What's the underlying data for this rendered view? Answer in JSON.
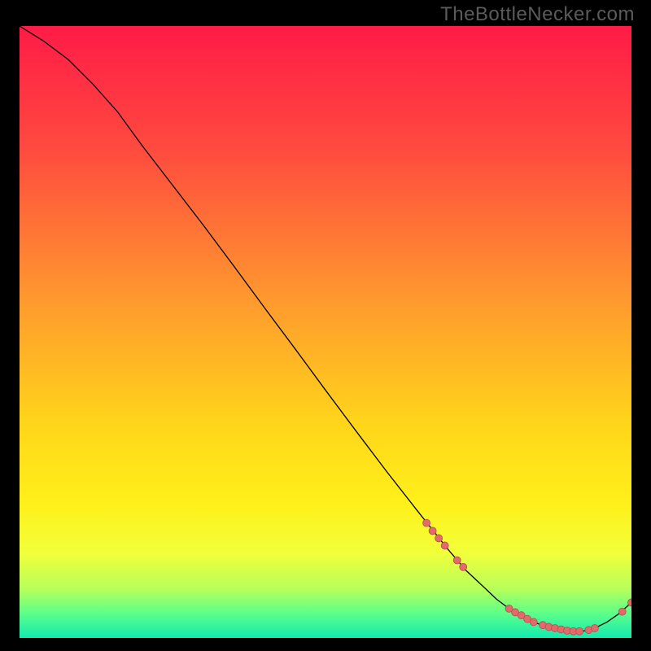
{
  "watermark": {
    "text": "TheBottleNecker.com"
  },
  "chart_data": {
    "type": "line",
    "title": "",
    "xlabel": "",
    "ylabel": "",
    "xlim": [
      0,
      100
    ],
    "ylim": [
      0,
      100
    ],
    "gradient_stops": [
      {
        "offset": 0.0,
        "color": "#ff1b47"
      },
      {
        "offset": 0.2,
        "color": "#ff4a3f"
      },
      {
        "offset": 0.45,
        "color": "#ff9a2e"
      },
      {
        "offset": 0.65,
        "color": "#ffd51a"
      },
      {
        "offset": 0.78,
        "color": "#fff01a"
      },
      {
        "offset": 0.86,
        "color": "#f2ff3a"
      },
      {
        "offset": 0.92,
        "color": "#b7ff5a"
      },
      {
        "offset": 0.96,
        "color": "#5bff8a"
      },
      {
        "offset": 1.0,
        "color": "#12eab0"
      }
    ],
    "series": [
      {
        "name": "bottleneck-curve",
        "color": "#000000",
        "width": 1.3,
        "x": [
          0,
          4,
          8,
          12,
          16,
          20,
          25,
          30,
          35,
          40,
          45,
          50,
          55,
          60,
          65,
          70,
          73,
          76,
          78,
          80,
          82,
          84,
          86,
          88,
          90,
          92,
          94,
          96,
          98,
          100
        ],
        "y": [
          100,
          97.5,
          94.5,
          90.5,
          86,
          80.5,
          74,
          67.5,
          60.8,
          54,
          47.3,
          40.5,
          33.8,
          27.2,
          20.8,
          14.5,
          11,
          8.2,
          6.3,
          4.8,
          3.6,
          2.6,
          1.9,
          1.4,
          1.1,
          1.1,
          1.6,
          2.6,
          4.0,
          5.8
        ]
      }
    ],
    "markers": {
      "color": "#e36a6a",
      "stroke": "#b24f4f",
      "radius": 4.5,
      "points": [
        {
          "x": 66.5,
          "y": 18.8
        },
        {
          "x": 67.5,
          "y": 17.5
        },
        {
          "x": 68.5,
          "y": 16.3
        },
        {
          "x": 69.5,
          "y": 15.1
        },
        {
          "x": 71.5,
          "y": 12.7
        },
        {
          "x": 72.5,
          "y": 11.6
        },
        {
          "x": 80.0,
          "y": 4.8
        },
        {
          "x": 81.0,
          "y": 4.2
        },
        {
          "x": 82.0,
          "y": 3.7
        },
        {
          "x": 83.0,
          "y": 3.1
        },
        {
          "x": 84.0,
          "y": 2.6
        },
        {
          "x": 85.5,
          "y": 2.1
        },
        {
          "x": 86.5,
          "y": 1.8
        },
        {
          "x": 87.5,
          "y": 1.6
        },
        {
          "x": 88.5,
          "y": 1.4
        },
        {
          "x": 89.5,
          "y": 1.2
        },
        {
          "x": 90.5,
          "y": 1.1
        },
        {
          "x": 91.5,
          "y": 1.1
        },
        {
          "x": 93.0,
          "y": 1.3
        },
        {
          "x": 94.0,
          "y": 1.6
        },
        {
          "x": 98.5,
          "y": 4.3
        },
        {
          "x": 100.0,
          "y": 5.8
        }
      ]
    }
  }
}
